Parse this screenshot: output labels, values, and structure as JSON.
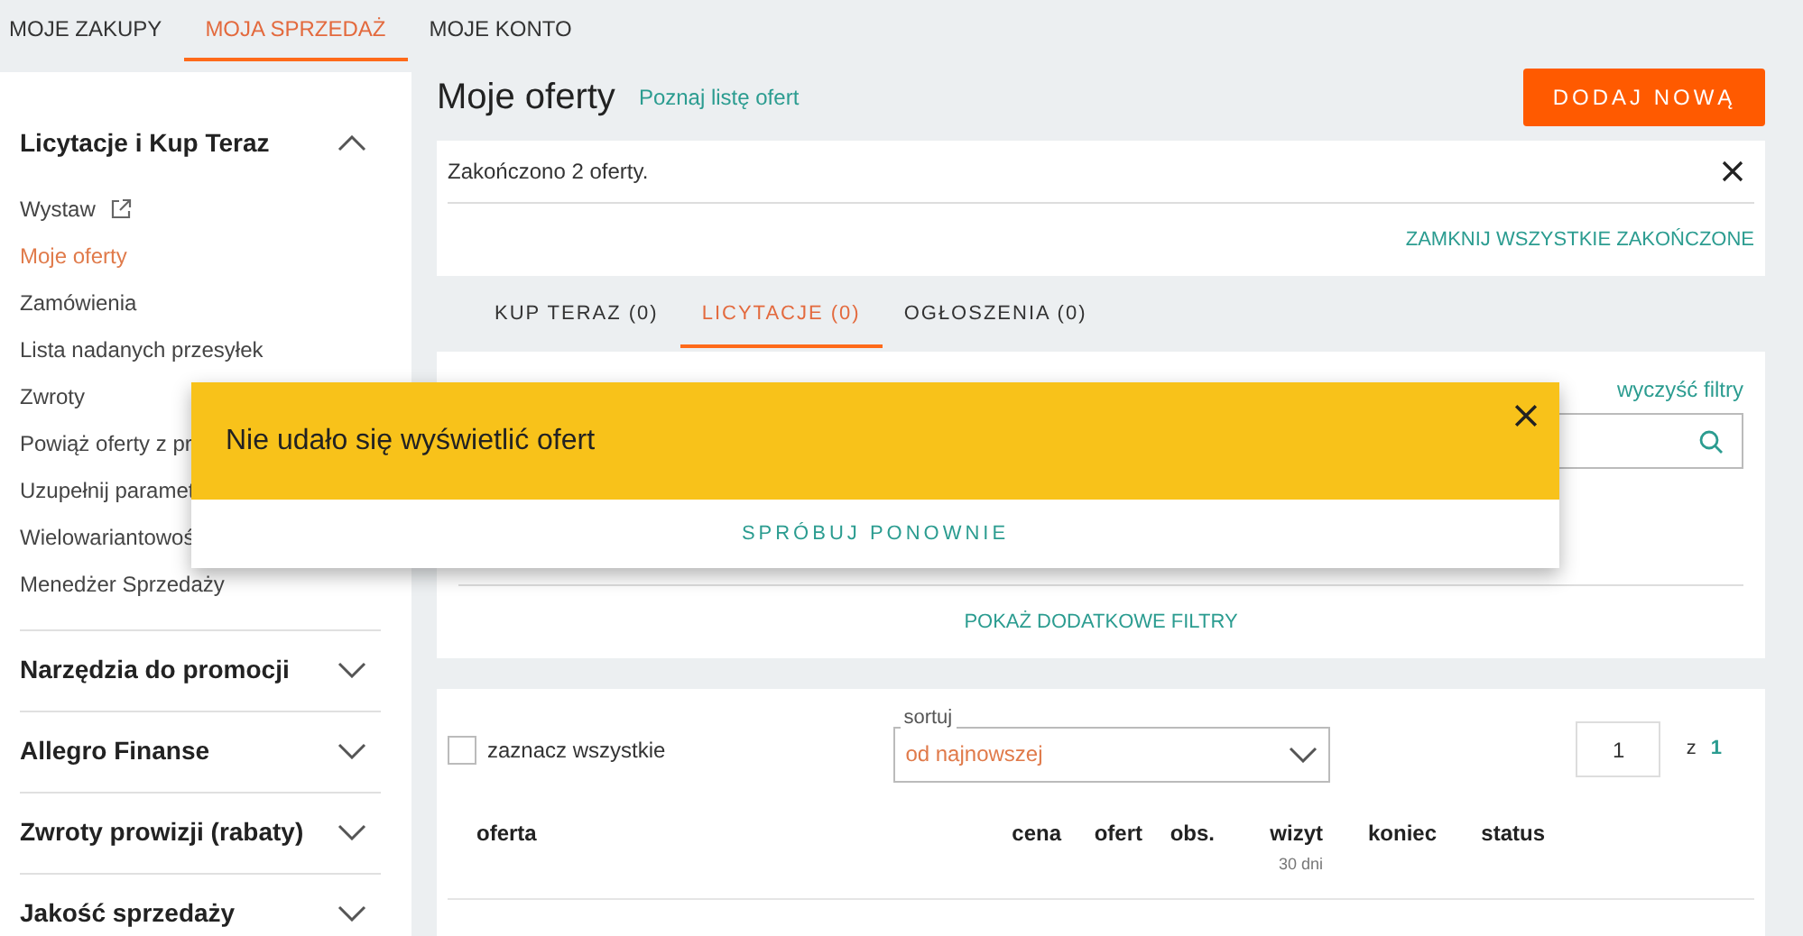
{
  "top_nav": [
    {
      "label": "MOJE ZAKUPY",
      "selected": false
    },
    {
      "label": "MOJA SPRZEDAŻ",
      "selected": true
    },
    {
      "label": "MOJE KONTO",
      "selected": false
    }
  ],
  "sidebar": {
    "sections": [
      {
        "title": "Licytacje i Kup Teraz",
        "expanded": true,
        "items": [
          {
            "label": "Wystaw",
            "kind": "external",
            "selected": false
          },
          {
            "label": "Moje oferty",
            "kind": "link",
            "selected": true
          },
          {
            "label": "Zamówienia",
            "kind": "link",
            "selected": false
          },
          {
            "label": "Lista nadanych przesyłek",
            "kind": "link",
            "selected": false
          },
          {
            "label": "Zwroty",
            "kind": "link",
            "selected": false
          },
          {
            "label": "Powiąż oferty z pr",
            "kind": "link",
            "selected": false
          },
          {
            "label": "Uzupełnij paramet",
            "kind": "link",
            "selected": false
          },
          {
            "label": "Wielowariantowoś",
            "kind": "link",
            "selected": false
          },
          {
            "label": "Menedżer Sprzedaży",
            "kind": "link",
            "selected": false
          }
        ]
      },
      {
        "title": "Narzędzia do promocji",
        "expanded": false
      },
      {
        "title": "Allegro Finanse",
        "expanded": false
      },
      {
        "title": "Zwroty prowizji (rabaty)",
        "expanded": false
      },
      {
        "title": "Jakość sprzedaży",
        "expanded": false
      }
    ]
  },
  "header": {
    "title": "Moje oferty",
    "link": "Poznaj listę ofert",
    "button": "DODAJ NOWĄ"
  },
  "notice": {
    "message": "Zakończono 2 oferty.",
    "action": "ZAMKNIJ WSZYSTKIE ZAKOŃCZONE"
  },
  "tabs": [
    {
      "label": "KUP TERAZ (0)",
      "selected": false
    },
    {
      "label": "LICYTACJE (0)",
      "selected": true
    },
    {
      "label": "OGŁOSZENIA (0)",
      "selected": false
    }
  ],
  "filters": {
    "clear": "wyczyść filtry",
    "more": "POKAŻ DODATKOWE FILTRY"
  },
  "list": {
    "select_all": {
      "label": "zaznacz wszystkie",
      "checked": false
    },
    "sort": {
      "label": "sortuj",
      "value": "od najnowszej"
    },
    "page": {
      "value": "1",
      "separator": "z",
      "total": "1"
    },
    "columns": [
      {
        "label": "oferta"
      },
      {
        "label": "cena"
      },
      {
        "label": "ofert"
      },
      {
        "label": "obs."
      },
      {
        "label": "wizyt",
        "sub": "30 dni"
      },
      {
        "label": "koniec"
      },
      {
        "label": "status"
      }
    ]
  },
  "dialog": {
    "title": "Nie udało się wyświetlić ofert",
    "action": "SPRÓBUJ PONOWNIE"
  }
}
